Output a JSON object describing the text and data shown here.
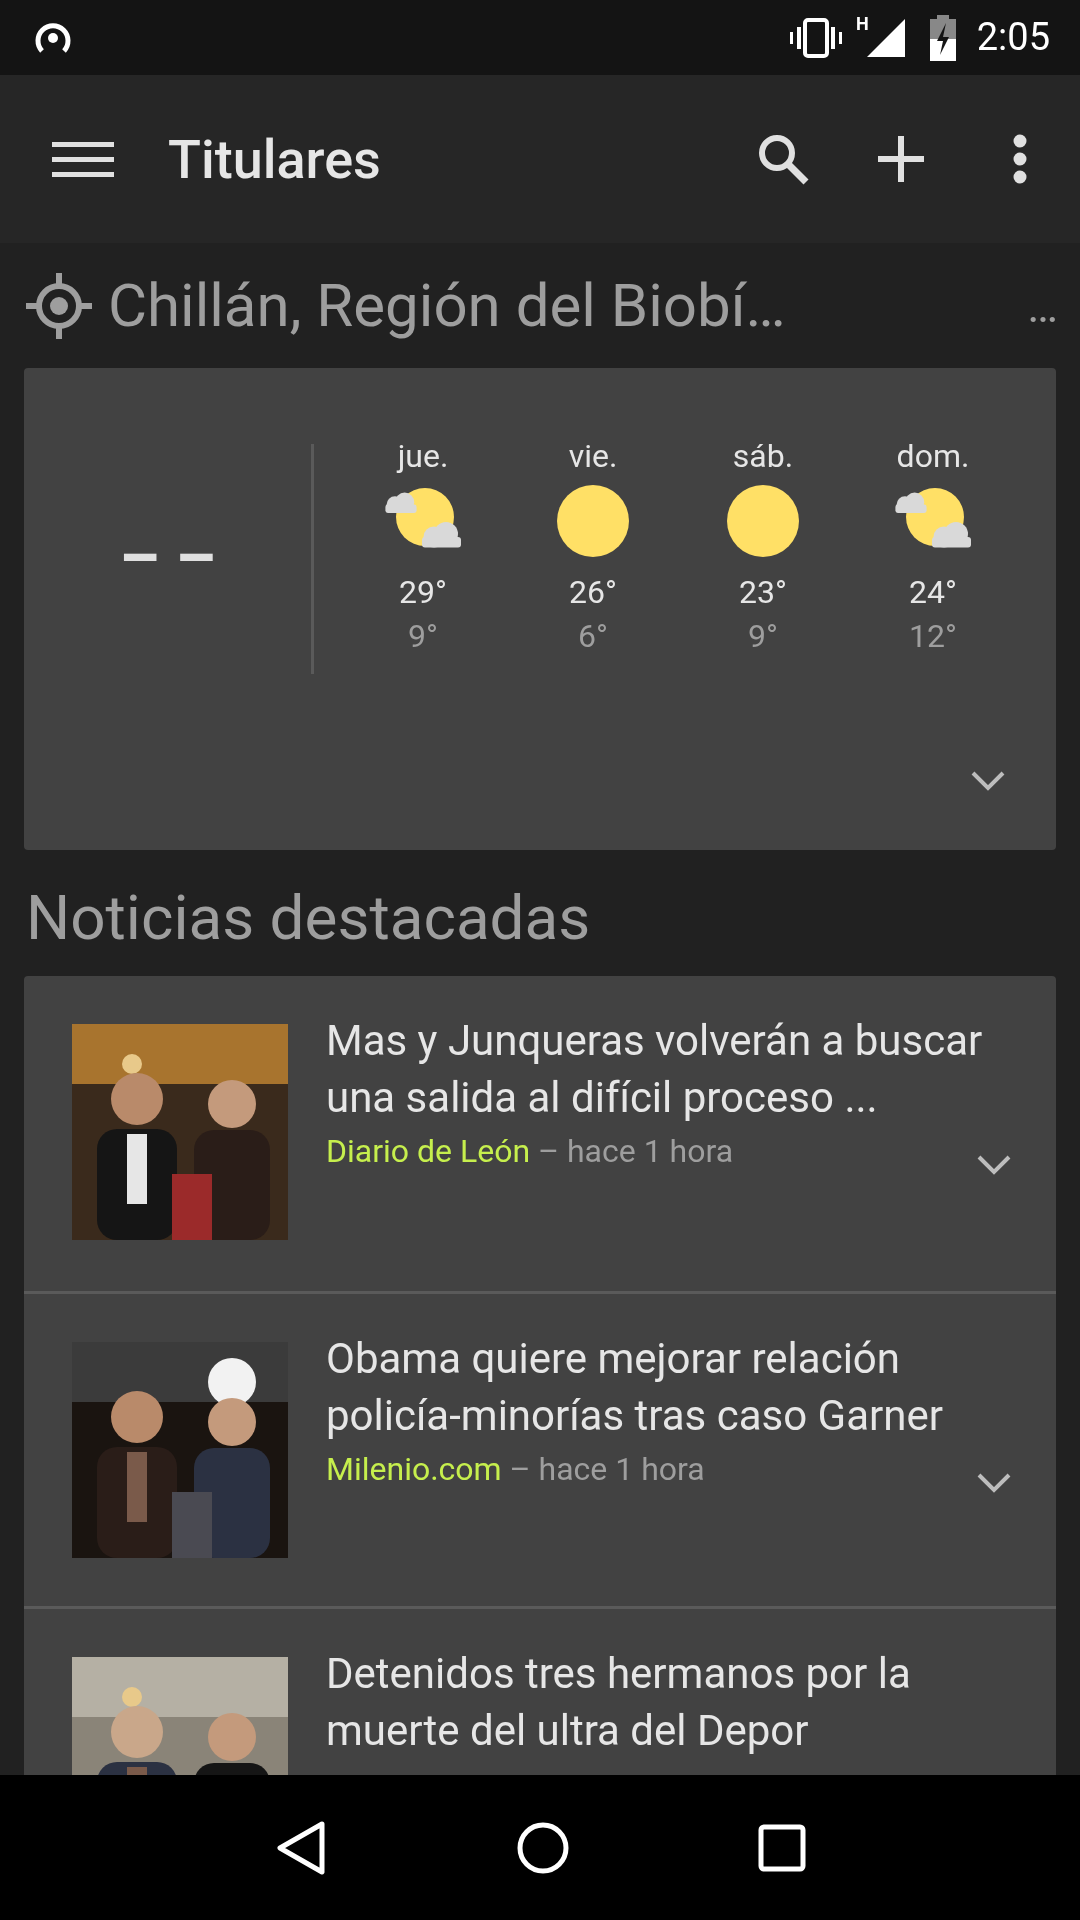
{
  "status_bar": {
    "time": "2:05",
    "network": "H"
  },
  "app_bar": {
    "title": "Titulares"
  },
  "location": {
    "name": "Chillán, Región del Biobí…",
    "more": "…"
  },
  "weather": {
    "current": "– –",
    "expanded": false,
    "days": [
      {
        "day": "jue.",
        "kind": "partly_cloudy",
        "high": "29°",
        "low": "9°"
      },
      {
        "day": "vie.",
        "kind": "sunny",
        "high": "26°",
        "low": "6°"
      },
      {
        "day": "sáb.",
        "kind": "sunny",
        "high": "23°",
        "low": "9°"
      },
      {
        "day": "dom.",
        "kind": "partly_cloudy",
        "high": "24°",
        "low": "12°"
      }
    ]
  },
  "section_title": "Noticias destacadas",
  "news": [
    {
      "title": "Mas y Junqueras volverán a buscar una salida al difícil proceso ...",
      "source": "Diario de León",
      "time": "– hace 1 hora"
    },
    {
      "title": "Obama quiere mejorar relación policía-minorías tras caso Garner",
      "source": "Milenio.com",
      "time": "– hace 1 hora"
    },
    {
      "title": "Detenidos tres hermanos por la muerte del ultra del Depor"
    }
  ]
}
